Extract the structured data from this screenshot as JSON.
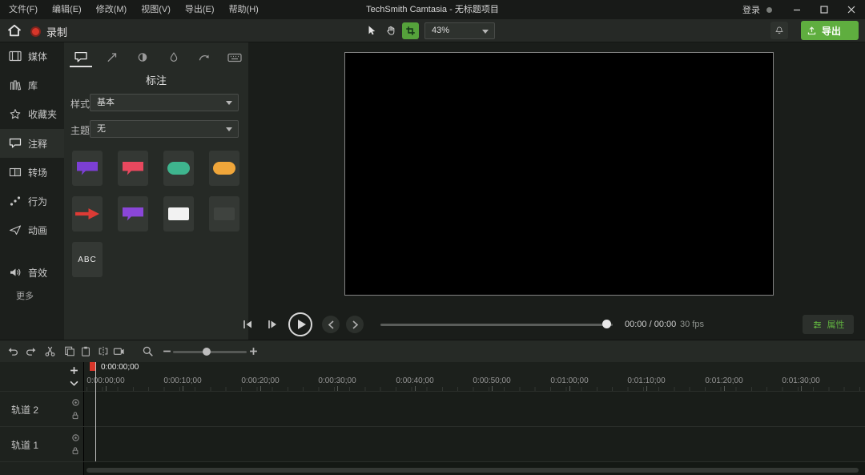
{
  "colors": {
    "accent_green": "#5fae3f",
    "record_red": "#d8362a",
    "crop_green": "#55a23b"
  },
  "titlebar": {
    "menus": [
      "文件(F)",
      "编辑(E)",
      "修改(M)",
      "视图(V)",
      "导出(E)",
      "帮助(H)"
    ],
    "title": "TechSmith Camtasia - 无标题项目",
    "signin": "登录"
  },
  "toolbar": {
    "record": "录制",
    "zoom": "43%",
    "export": "导出"
  },
  "sidebar": {
    "items": [
      "媒体",
      "库",
      "收藏夹",
      "注释",
      "转场",
      "行为",
      "动画",
      "音效",
      "更多"
    ]
  },
  "panel": {
    "title": "标注",
    "style_label": "样式",
    "style_value": "基本",
    "theme_label": "主题",
    "theme_value": "无",
    "abc": "ABC",
    "callout_colors": {
      "purple": "#7c3fd4",
      "red": "#e8485e",
      "green": "#3eb58e",
      "yellow": "#f0a63a",
      "burst_red": "#dd3b35",
      "purple2": "#8a46d8",
      "white": "#f2f2f2",
      "faint": "#3f433f"
    }
  },
  "preview": {
    "time": "00:00 / 00:00",
    "fps": "30 fps",
    "properties": "属性"
  },
  "timeline": {
    "playhead_time": "0:00:00;00",
    "ruler": [
      "0:00:00;00",
      "0:00:10;00",
      "0:00:20;00",
      "0:00:30;00",
      "0:00:40;00",
      "0:00:50;00",
      "0:01:00;00",
      "0:01:10;00",
      "0:01:20;00",
      "0:01:30;00"
    ],
    "tracks": [
      {
        "label": "轨道 2"
      },
      {
        "label": "轨道 1"
      }
    ]
  }
}
